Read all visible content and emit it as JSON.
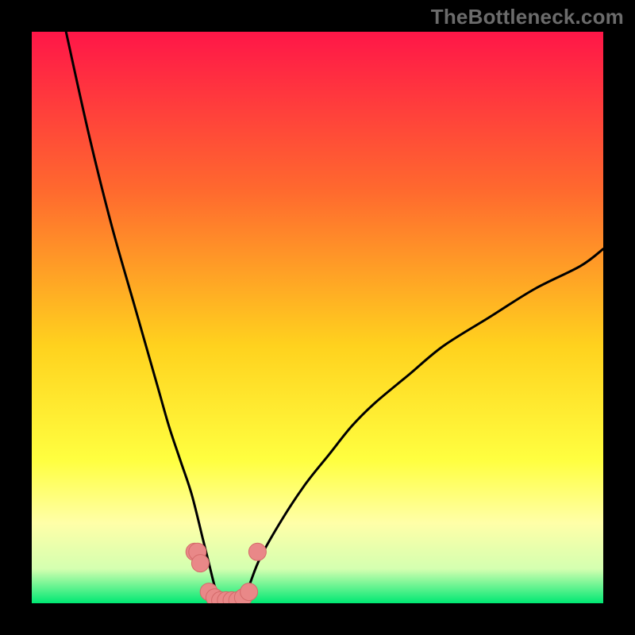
{
  "watermark": "TheBottleneck.com",
  "colors": {
    "frame": "#000000",
    "grad_top": "#ff1648",
    "grad_mid1": "#ff6a2e",
    "grad_mid2": "#ffd21e",
    "grad_mid3": "#ffff40",
    "grad_low1": "#ffffa8",
    "grad_low2": "#d4ffb0",
    "grad_bottom": "#00e873",
    "curve": "#000000",
    "marker_fill": "#e98888",
    "marker_stroke": "#d46a6a"
  },
  "chart_data": {
    "type": "line",
    "title": "",
    "xlabel": "",
    "ylabel": "",
    "xlim": [
      0,
      100
    ],
    "ylim": [
      0,
      100
    ],
    "note": "V-shaped bottleneck curve; minimum near x≈33, y≈0. Left branch rises steeply to ~100 at x≈6; right branch rises with decreasing slope to ~62 at x=100.",
    "series": [
      {
        "name": "bottleneck-curve",
        "x": [
          6,
          10,
          14,
          18,
          22,
          24,
          26,
          28,
          30,
          31,
          32,
          33,
          34,
          35,
          36,
          37,
          38,
          40,
          44,
          48,
          52,
          56,
          60,
          66,
          72,
          80,
          88,
          96,
          100
        ],
        "y": [
          100,
          82,
          66,
          52,
          38,
          31,
          25,
          19,
          11,
          7,
          3,
          0,
          0,
          0,
          0,
          1,
          3,
          8,
          15,
          21,
          26,
          31,
          35,
          40,
          45,
          50,
          55,
          59,
          62
        ]
      }
    ],
    "markers": [
      {
        "x": 28.5,
        "y": 9
      },
      {
        "x": 29.0,
        "y": 9
      },
      {
        "x": 29.5,
        "y": 7
      },
      {
        "x": 31.0,
        "y": 2
      },
      {
        "x": 32.0,
        "y": 1
      },
      {
        "x": 33.0,
        "y": 0.5
      },
      {
        "x": 34.0,
        "y": 0.5
      },
      {
        "x": 35.0,
        "y": 0.5
      },
      {
        "x": 36.0,
        "y": 0.5
      },
      {
        "x": 37.0,
        "y": 1
      },
      {
        "x": 38.0,
        "y": 2
      },
      {
        "x": 39.5,
        "y": 9
      }
    ]
  }
}
